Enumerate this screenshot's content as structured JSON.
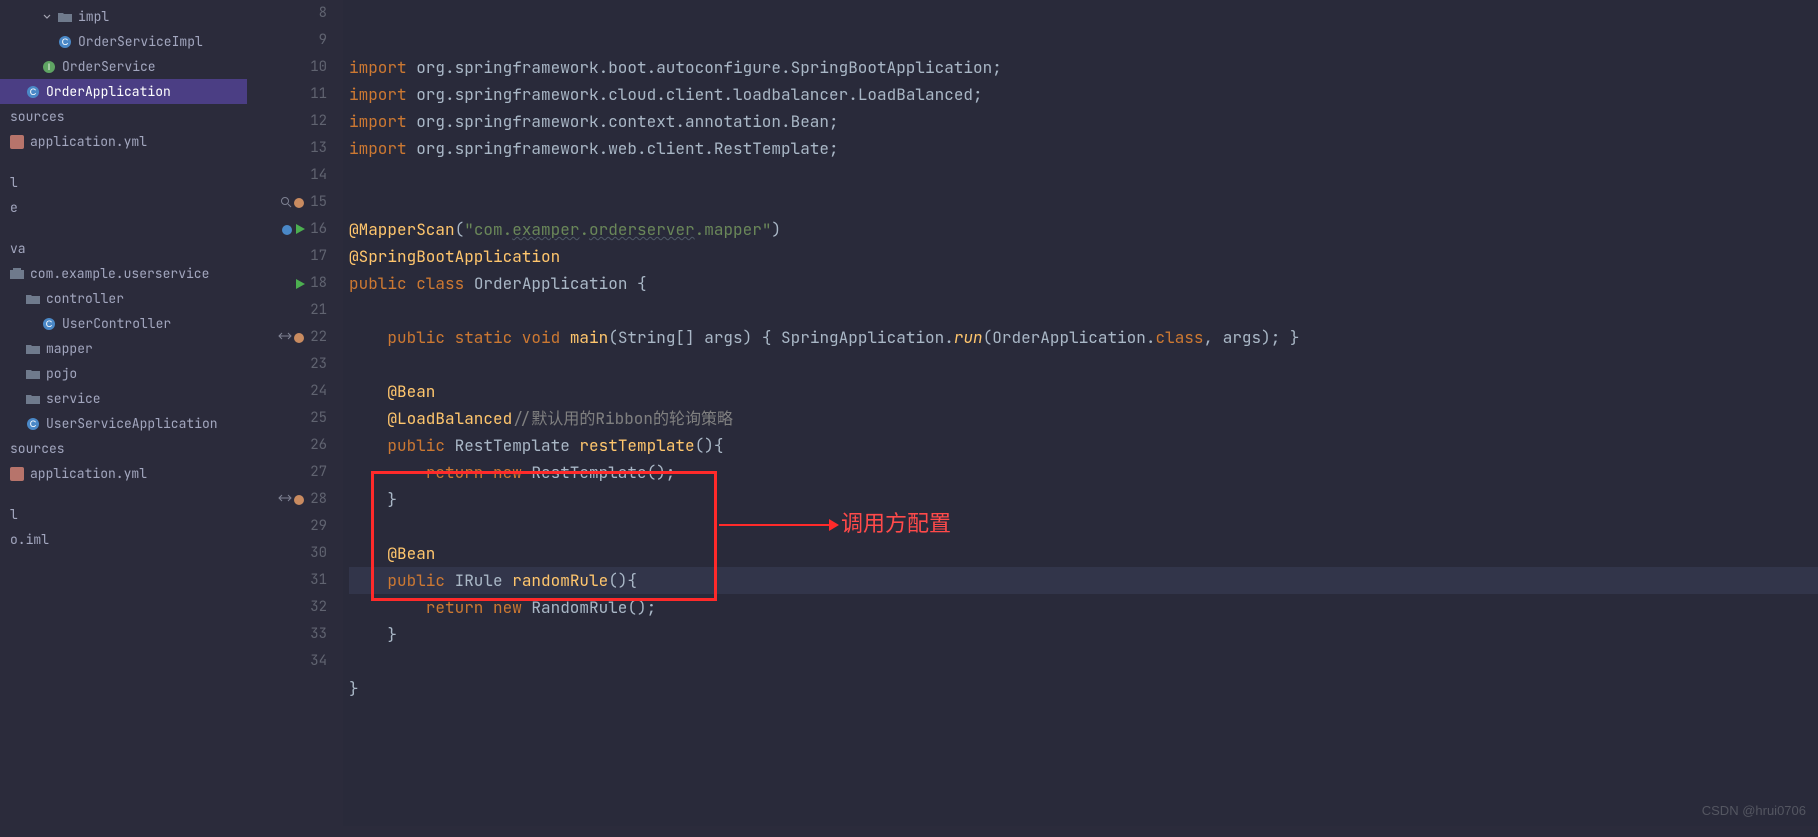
{
  "tree": [
    {
      "depth": 2,
      "label": "impl",
      "kind": "folder-open",
      "selected": false,
      "arrow": "down-small"
    },
    {
      "depth": 3,
      "label": "OrderServiceImpl",
      "kind": "class",
      "selected": false
    },
    {
      "depth": 2,
      "label": "OrderService",
      "kind": "interface",
      "selected": false
    },
    {
      "depth": 1,
      "label": "OrderApplication",
      "kind": "class",
      "selected": true
    },
    {
      "depth": 0,
      "label": "sources",
      "kind": "text",
      "selected": false
    },
    {
      "depth": 0,
      "label": "application.yml",
      "kind": "yml",
      "selected": false
    },
    {
      "depth": 0,
      "label": "l",
      "kind": "text",
      "selected": false
    },
    {
      "depth": 0,
      "label": "e",
      "kind": "text",
      "selected": false
    },
    {
      "depth": 0,
      "label": "va",
      "kind": "text",
      "selected": false
    },
    {
      "depth": 0,
      "label": "com.example.userservice",
      "kind": "package",
      "selected": false
    },
    {
      "depth": 1,
      "label": "controller",
      "kind": "folder",
      "selected": false
    },
    {
      "depth": 2,
      "label": "UserController",
      "kind": "class",
      "selected": false
    },
    {
      "depth": 1,
      "label": "mapper",
      "kind": "folder",
      "selected": false
    },
    {
      "depth": 1,
      "label": "pojo",
      "kind": "folder",
      "selected": false
    },
    {
      "depth": 1,
      "label": "service",
      "kind": "folder",
      "selected": false
    },
    {
      "depth": 1,
      "label": "UserServiceApplication",
      "kind": "class",
      "selected": false
    },
    {
      "depth": 0,
      "label": "sources",
      "kind": "text",
      "selected": false
    },
    {
      "depth": 0,
      "label": "application.yml",
      "kind": "yml",
      "selected": false
    },
    {
      "depth": 0,
      "label": "l",
      "kind": "text",
      "selected": false
    },
    {
      "depth": 0,
      "label": "o.iml",
      "kind": "text",
      "selected": false
    }
  ],
  "gutter": [
    {
      "n": 8
    },
    {
      "n": 9
    },
    {
      "n": 10
    },
    {
      "n": 11
    },
    {
      "n": 12
    },
    {
      "n": 13
    },
    {
      "n": 14
    },
    {
      "n": 15,
      "marks": [
        "search",
        "bean"
      ]
    },
    {
      "n": 16,
      "marks": [
        "class",
        "run"
      ]
    },
    {
      "n": 17
    },
    {
      "n": 18,
      "marks": [
        "run"
      ]
    },
    {
      "n": 21
    },
    {
      "n": 22,
      "marks": [
        "impl",
        "bean"
      ]
    },
    {
      "n": 23
    },
    {
      "n": 24
    },
    {
      "n": 25
    },
    {
      "n": 26
    },
    {
      "n": 27
    },
    {
      "n": 28,
      "marks": [
        "impl",
        "bean"
      ]
    },
    {
      "n": 29
    },
    {
      "n": 30
    },
    {
      "n": 31
    },
    {
      "n": 32
    },
    {
      "n": 33
    },
    {
      "n": 34
    }
  ],
  "code": [
    [
      {
        "t": "import ",
        "c": "kw"
      },
      {
        "t": "org.springframework.boot.autoconfigure.",
        "c": "id"
      },
      {
        "t": "SpringBootApplication",
        "c": "id"
      },
      {
        "t": ";",
        "c": "pun"
      }
    ],
    [
      {
        "t": "import ",
        "c": "kw"
      },
      {
        "t": "org.springframework.cloud.client.loadbalancer.",
        "c": "id"
      },
      {
        "t": "LoadBalanced",
        "c": "id"
      },
      {
        "t": ";",
        "c": "pun"
      }
    ],
    [
      {
        "t": "import ",
        "c": "kw"
      },
      {
        "t": "org.springframework.context.annotation.",
        "c": "id"
      },
      {
        "t": "Bean",
        "c": "id"
      },
      {
        "t": ";",
        "c": "pun"
      }
    ],
    [
      {
        "t": "import ",
        "c": "kw"
      },
      {
        "t": "org.springframework.web.client.",
        "c": "id"
      },
      {
        "t": "RestTemplate",
        "c": "id"
      },
      {
        "t": ";",
        "c": "pun"
      }
    ],
    [],
    [],
    [
      {
        "t": "@MapperScan",
        "c": "ann"
      },
      {
        "t": "(",
        "c": "pun"
      },
      {
        "t": "\"com.",
        "c": "str"
      },
      {
        "t": "examper",
        "c": "str wavy"
      },
      {
        "t": ".",
        "c": "str"
      },
      {
        "t": "orderserver",
        "c": "str wavy"
      },
      {
        "t": ".mapper\"",
        "c": "str"
      },
      {
        "t": ")",
        "c": "pun"
      }
    ],
    [
      {
        "t": "@SpringBootApplication",
        "c": "ann"
      }
    ],
    [
      {
        "t": "public class ",
        "c": "kw"
      },
      {
        "t": "OrderApplication ",
        "c": "cls"
      },
      {
        "t": "{",
        "c": "pun"
      }
    ],
    [],
    [
      {
        "t": "    public static void ",
        "c": "kw"
      },
      {
        "t": "main",
        "c": "method"
      },
      {
        "t": "(",
        "c": "pun"
      },
      {
        "t": "String[] args",
        "c": "id"
      },
      {
        "t": ") { ",
        "c": "pun"
      },
      {
        "t": "SpringApplication",
        "c": "id"
      },
      {
        "t": ".",
        "c": "pun"
      },
      {
        "t": "run",
        "c": "method italic"
      },
      {
        "t": "(",
        "c": "pun"
      },
      {
        "t": "OrderApplication",
        "c": "id"
      },
      {
        "t": ".",
        "c": "pun"
      },
      {
        "t": "class",
        "c": "kw"
      },
      {
        "t": ", args); }",
        "c": "pun"
      }
    ],
    [],
    [
      {
        "t": "    @Bean",
        "c": "ann"
      }
    ],
    [
      {
        "t": "    @LoadBalanced",
        "c": "ann"
      },
      {
        "t": "//默认用的Ribbon的轮询策略",
        "c": "comment"
      }
    ],
    [
      {
        "t": "    public ",
        "c": "kw"
      },
      {
        "t": "RestTemplate ",
        "c": "cls"
      },
      {
        "t": "restTemplate",
        "c": "method"
      },
      {
        "t": "(){",
        "c": "pun"
      }
    ],
    [
      {
        "t": "        return new ",
        "c": "kw"
      },
      {
        "t": "RestTemplate",
        "c": "cls"
      },
      {
        "t": "();",
        "c": "pun"
      }
    ],
    [
      {
        "t": "    }",
        "c": "pun"
      }
    ],
    [],
    [
      {
        "t": "    @Bean",
        "c": "ann"
      }
    ],
    [
      {
        "t": "    public ",
        "c": "kw"
      },
      {
        "t": "IRule ",
        "c": "cls"
      },
      {
        "t": "randomRule",
        "c": "method"
      },
      {
        "t": "(){",
        "c": "pun"
      }
    ],
    [
      {
        "t": "        return new ",
        "c": "kw"
      },
      {
        "t": "RandomRule",
        "c": "cls"
      },
      {
        "t": "();",
        "c": "pun"
      }
    ],
    [
      {
        "t": "    }",
        "c": "pun"
      }
    ],
    [],
    [
      {
        "t": "}",
        "c": "pun"
      }
    ],
    []
  ],
  "cursorLineIndex": 19,
  "annotation": {
    "label": "调用方配置"
  },
  "watermark": "CSDN @hrui0706"
}
